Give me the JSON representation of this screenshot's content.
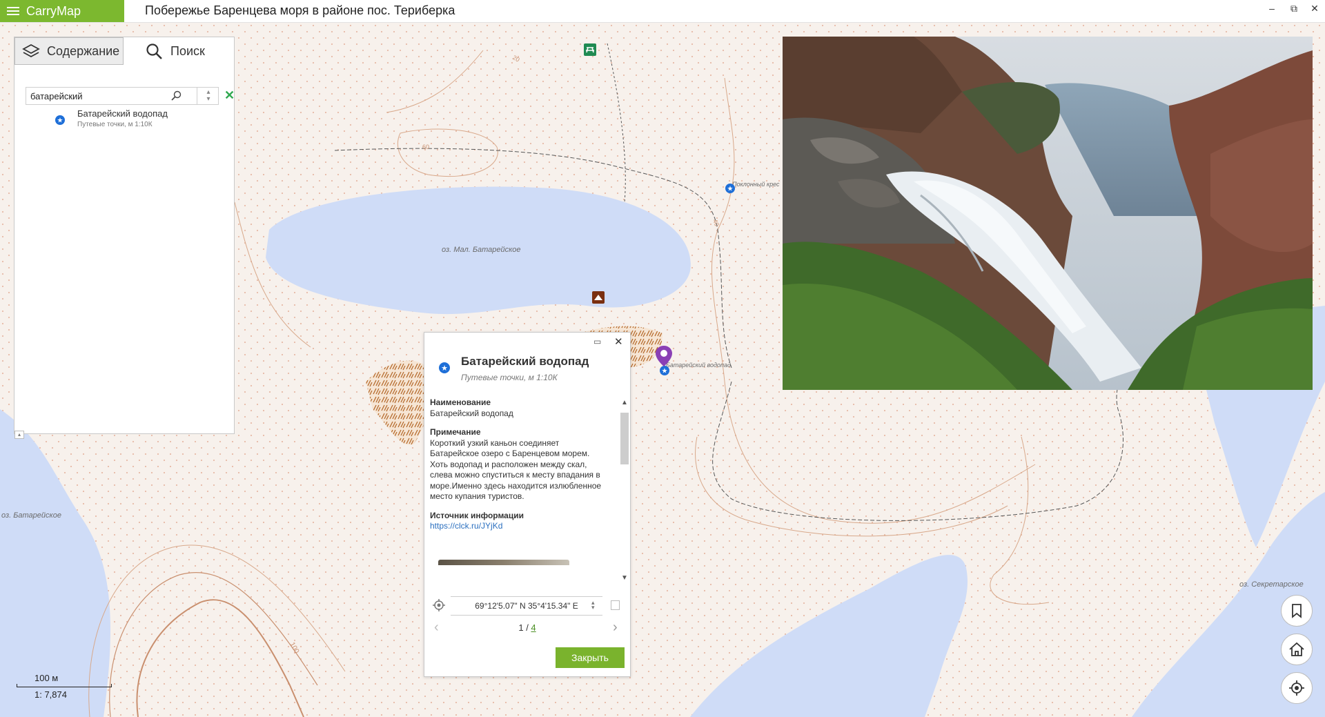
{
  "app": {
    "name": "CarryMap",
    "window_title": "Побережье Баренцева моря в районе пос. Териберка"
  },
  "window_controls": [
    "–",
    "⧉",
    "✕"
  ],
  "panel": {
    "tabs": [
      {
        "label": "Содержание",
        "icon": "layers-icon"
      },
      {
        "label": "Поиск",
        "icon": "search-icon"
      }
    ],
    "search": {
      "value": "батарейский"
    },
    "results": [
      {
        "title": "Батарейский водопад",
        "subtitle": "Путевые точки, м 1:10К"
      }
    ]
  },
  "map": {
    "labels": {
      "lake_small": "оз. Мал. Батарейское",
      "lake_left": "оз. Батарейское",
      "lake_right": "оз. Секретарское",
      "poi_waterfall": "Батарейский водопад",
      "poi_cross": "Поклонный крес",
      "contour_100": "100",
      "contour_20": "20",
      "contour_60": "60",
      "contour_40": "40"
    },
    "accent_colors": {
      "brand": "#7cb82f",
      "water": "#cfdcf7",
      "contour": "#c98f6e",
      "marker": "#1e6fd8",
      "pin": "#8a3fb5"
    }
  },
  "popup": {
    "title": "Батарейский водопад",
    "subtitle": "Путевые точки, м 1:10К",
    "fields": [
      {
        "label": "Наименование",
        "value": "Батарейский водопад"
      },
      {
        "label": "Примечание",
        "value": "Короткий узкий каньон соединяет Батарейское озеро с Баренцевом морем. Хоть водопад и расположен между скал, слева можно спуститься к месту впадания в море.Именно здесь находится излюбленное место купания туристов."
      },
      {
        "label": "Источник информации",
        "value": "https://clck.ru/JYjKd"
      }
    ],
    "coordinates": "69°12'5.07\" N 35°4'15.34\" E",
    "pager": {
      "current": "1",
      "separator": " / ",
      "total": "4"
    },
    "close_label": "Закрыть"
  },
  "scale": {
    "distance": "100 м",
    "ratio": "1: 7,874"
  },
  "side_buttons": [
    "bookmark-icon",
    "home-icon",
    "locate-icon"
  ]
}
